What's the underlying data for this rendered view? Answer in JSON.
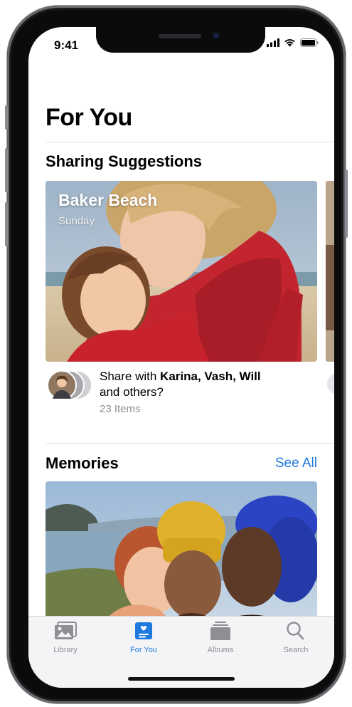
{
  "status_bar": {
    "time": "9:41"
  },
  "page": {
    "title": "For You"
  },
  "sharing": {
    "section_title": "Sharing Suggestions",
    "card": {
      "title": "Baker Beach",
      "subtitle": "Sunday"
    },
    "share_prefix": "Share with ",
    "share_names": "Karina, Vash, Will",
    "share_suffix": "and others?",
    "items_count": "23 Items"
  },
  "memories": {
    "section_title": "Memories",
    "see_all": "See All"
  },
  "tab_bar": {
    "tabs": [
      {
        "label": "Library",
        "icon": "photo-library-icon",
        "active": false
      },
      {
        "label": "For You",
        "icon": "for-you-icon",
        "active": true
      },
      {
        "label": "Albums",
        "icon": "albums-icon",
        "active": false
      },
      {
        "label": "Search",
        "icon": "search-icon",
        "active": false
      }
    ]
  },
  "colors": {
    "accent": "#1f7ae0",
    "tab_inactive": "#8e8e93"
  }
}
